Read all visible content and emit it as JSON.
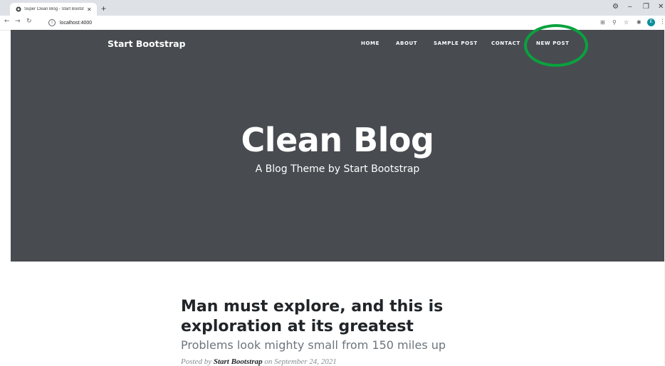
{
  "browser": {
    "tab_title": "Super Clean Blog - Start Bootstrap",
    "new_tab_label": "+",
    "address": "localhost:4000",
    "win_controls": [
      "⚙",
      "–",
      "❐",
      "✕"
    ],
    "profile_initial": "E",
    "icons": [
      "back-arrow-icon",
      "forward-arrow-icon",
      "reload-icon",
      "info-icon",
      "translate-icon",
      "zoom-icon",
      "star-icon",
      "extensions-icon",
      "menu-icon"
    ]
  },
  "nav": {
    "brand": "Start Bootstrap",
    "links": [
      "HOME",
      "ABOUT",
      "SAMPLE POST",
      "CONTACT",
      "NEW POST"
    ]
  },
  "header": {
    "heading": "Clean Blog",
    "subheading": "A Blog Theme by Start Bootstrap"
  },
  "post": {
    "title": "Man must explore, and this is exploration at its greatest",
    "subtitle": "Problems look mighty small from 150 miles up",
    "meta_prefix": "Posted by",
    "author": "Start Bootstrap",
    "meta_mid": "on",
    "date": "September 24, 2021"
  },
  "colors": {
    "masthead_bg": "#484c51",
    "highlight_ring": "#0aa23e"
  }
}
